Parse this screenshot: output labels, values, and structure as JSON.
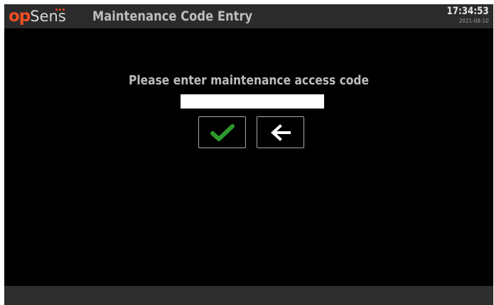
{
  "header": {
    "logo": {
      "part1": "op",
      "part2": "Sens"
    },
    "title": "Maintenance Code Entry",
    "clock": {
      "time": "17:34:53",
      "date": "2021-08-10"
    }
  },
  "main": {
    "prompt": "Please enter maintenance access code",
    "code_input": {
      "value": "",
      "placeholder": ""
    },
    "buttons": {
      "confirm_icon": "checkmark-icon",
      "back_icon": "left-arrow-icon"
    }
  },
  "colors": {
    "brand_orange": "#f04e23",
    "confirm_green": "#2e9a2e",
    "background": "#000000",
    "header_bar": "#2b2b2b"
  }
}
